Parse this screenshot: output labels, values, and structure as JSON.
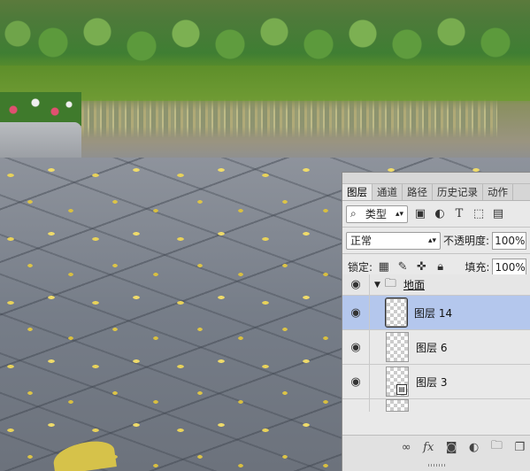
{
  "panel": {
    "tabs": [
      "图层",
      "通道",
      "路径",
      "历史记录",
      "动作"
    ],
    "filter": {
      "kind_label": "类型",
      "icons": [
        "image-filter-icon",
        "adjustment-filter-icon",
        "type-filter-icon",
        "shape-filter-icon",
        "smart-object-filter-icon"
      ]
    },
    "blend_mode": "正常",
    "opacity_label": "不透明度:",
    "opacity_value": "100%",
    "lock_label": "锁定:",
    "fill_label": "填充:",
    "fill_value": "100%",
    "group": {
      "name": "地面"
    },
    "layers": [
      {
        "name": "图层 14",
        "selected": true
      },
      {
        "name": "图层 6",
        "selected": false
      },
      {
        "name": "图层 3",
        "selected": false,
        "smart_object": true
      }
    ],
    "footer_icons": [
      "link-icon",
      "fx-icon",
      "mask-icon",
      "adjustment-icon",
      "folder-icon",
      "new-layer-icon"
    ],
    "colors": {
      "selected_row": "#b4c7ed",
      "panel_bg": "#e9e9e9"
    }
  }
}
